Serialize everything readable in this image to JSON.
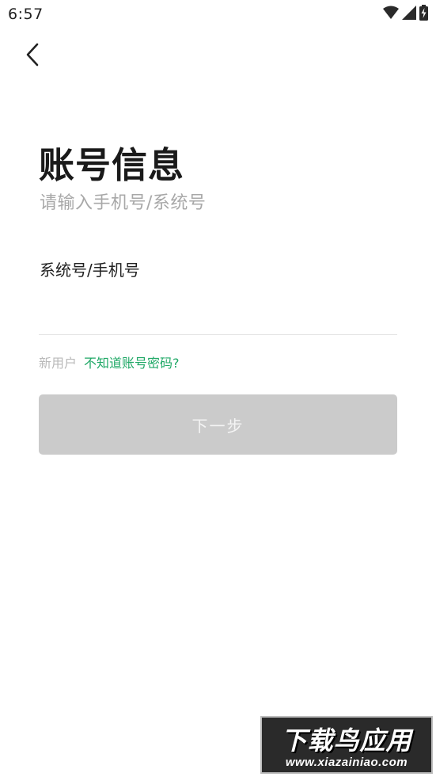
{
  "status_bar": {
    "time": "6:57",
    "icons": [
      "wifi-icon",
      "signal-icon",
      "battery-charging-icon"
    ]
  },
  "header": {
    "back_icon": "chevron-left-icon"
  },
  "main": {
    "title": "账号信息",
    "subtitle": "请输入手机号/系统号",
    "field_label": "系统号/手机号",
    "input_value": "",
    "input_placeholder": "",
    "new_user_label": "新用户",
    "forgot_link": "不知道账号密码?",
    "next_button": "下一步"
  },
  "watermark": {
    "title": "下载鸟应用",
    "url": "www.xiazainiao.com"
  },
  "colors": {
    "accent_green": "#1fa866",
    "button_disabled": "#cbcbcb",
    "subtitle_gray": "#a8a8a8"
  }
}
